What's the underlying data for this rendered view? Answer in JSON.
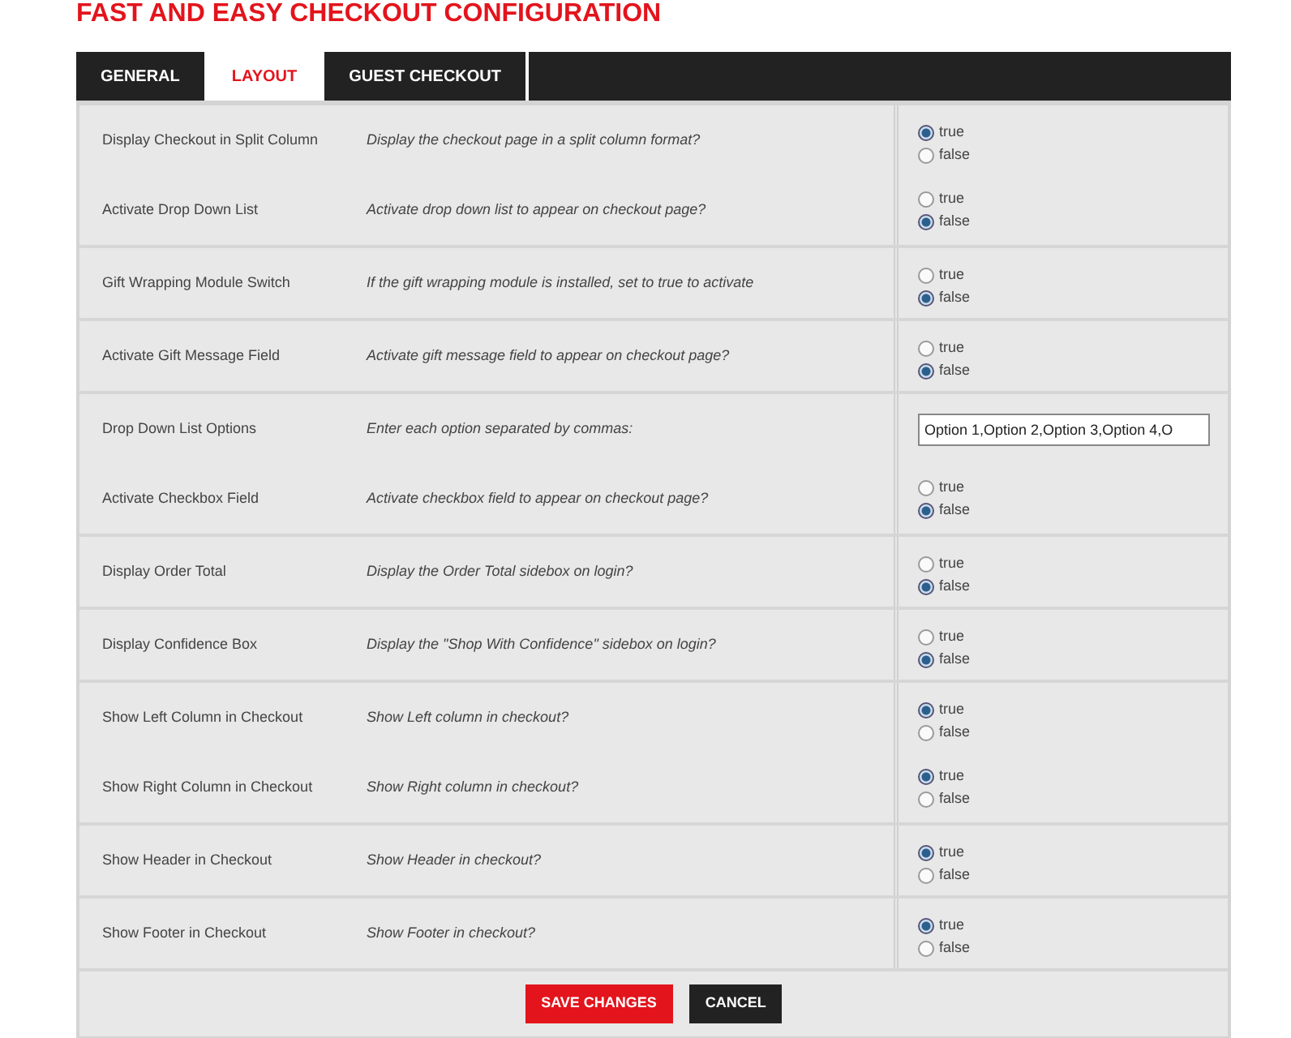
{
  "title": "FAST AND EASY CHECKOUT CONFIGURATION",
  "tabs": [
    {
      "label": "GENERAL",
      "selected": false
    },
    {
      "label": "LAYOUT",
      "selected": true
    },
    {
      "label": "GUEST CHECKOUT",
      "selected": false
    }
  ],
  "groups": [
    {
      "settings": [
        {
          "name": "Display Checkout in Split Column",
          "description": "Display the checkout page in a split column format?",
          "kind": "radio",
          "options": [
            {
              "label": "true",
              "selected": true
            },
            {
              "label": "false",
              "selected": false
            }
          ]
        },
        {
          "name": "Activate Drop Down List",
          "description": "Activate drop down list to appear on checkout page?",
          "kind": "radio",
          "options": [
            {
              "label": "true",
              "selected": false
            },
            {
              "label": "false",
              "selected": true
            }
          ]
        }
      ]
    },
    {
      "settings": [
        {
          "name": "Gift Wrapping Module Switch",
          "description": "If the gift wrapping module is installed, set to true to activate",
          "kind": "radio",
          "options": [
            {
              "label": "true",
              "selected": false
            },
            {
              "label": "false",
              "selected": true
            }
          ]
        }
      ]
    },
    {
      "settings": [
        {
          "name": "Activate Gift Message Field",
          "description": "Activate gift message field to appear on checkout page?",
          "kind": "radio",
          "options": [
            {
              "label": "true",
              "selected": false
            },
            {
              "label": "false",
              "selected": true
            }
          ]
        }
      ]
    },
    {
      "settings": [
        {
          "name": "Drop Down List Options",
          "description": "Enter each option separated by commas:",
          "kind": "text",
          "value": "Option 1,Option 2,Option 3,Option 4,O"
        },
        {
          "name": "Activate Checkbox Field",
          "description": "Activate checkbox field to appear on checkout page?",
          "kind": "radio",
          "options": [
            {
              "label": "true",
              "selected": false
            },
            {
              "label": "false",
              "selected": true
            }
          ]
        }
      ]
    },
    {
      "settings": [
        {
          "name": "Display Order Total",
          "description": "Display the Order Total sidebox on login?",
          "kind": "radio",
          "options": [
            {
              "label": "true",
              "selected": false
            },
            {
              "label": "false",
              "selected": true
            }
          ]
        }
      ]
    },
    {
      "settings": [
        {
          "name": "Display Confidence Box",
          "description": "Display the \"Shop With Confidence\" sidebox on login?",
          "kind": "radio",
          "options": [
            {
              "label": "true",
              "selected": false
            },
            {
              "label": "false",
              "selected": true
            }
          ]
        }
      ]
    },
    {
      "settings": [
        {
          "name": "Show Left Column in Checkout",
          "description": "Show Left column in checkout?",
          "kind": "radio",
          "options": [
            {
              "label": "true",
              "selected": true
            },
            {
              "label": "false",
              "selected": false
            }
          ]
        },
        {
          "name": "Show Right Column in Checkout",
          "description": "Show Right column in checkout?",
          "kind": "radio",
          "options": [
            {
              "label": "true",
              "selected": true
            },
            {
              "label": "false",
              "selected": false
            }
          ]
        }
      ]
    },
    {
      "settings": [
        {
          "name": "Show Header in Checkout",
          "description": "Show Header in checkout?",
          "kind": "radio",
          "options": [
            {
              "label": "true",
              "selected": true
            },
            {
              "label": "false",
              "selected": false
            }
          ]
        }
      ]
    },
    {
      "settings": [
        {
          "name": "Show Footer in Checkout",
          "description": "Show Footer in checkout?",
          "kind": "radio",
          "options": [
            {
              "label": "true",
              "selected": true
            },
            {
              "label": "false",
              "selected": false
            }
          ]
        }
      ]
    }
  ],
  "buttons": [
    {
      "label": "SAVE CHANGES",
      "kind": "primary"
    },
    {
      "label": "CANCEL",
      "kind": "secondary"
    }
  ]
}
